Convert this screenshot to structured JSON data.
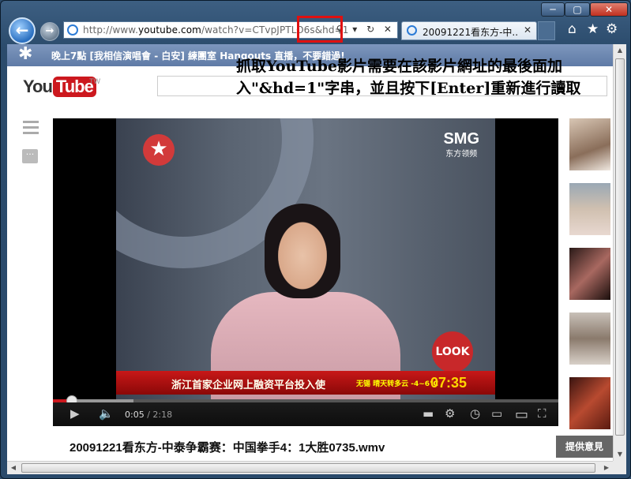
{
  "browser": {
    "url_prefix": "http://www.",
    "url_host": "youtube.com",
    "url_rest": "/watch?v=CTvpJPTLO6s&hd=1",
    "tab_title": "20091221看东方-中...",
    "tab_close": "✕",
    "window": {
      "minimize": "─",
      "maximize": "▢",
      "close": "✕"
    },
    "nav": {
      "back": "←",
      "forward": "→"
    },
    "addr_tools": "⚲ ▾ ↻ ✕",
    "toolbar_icons": {
      "home": "⌂",
      "favorites": "★",
      "settings": "⚙"
    }
  },
  "banner": {
    "icon": "✱",
    "text": "晚上7點 [我相信演唱會 - 白安] 練團室 Hangouts 直播，不要錯過!"
  },
  "logo": {
    "you": "You",
    "tube": "Tube",
    "region": "TW"
  },
  "annotation": "抓取YouTube影片需要在該影片網址的最後面加入\"&hd=1\"字串，並且按下[Enter]重新進行讀取",
  "sidebar": {
    "more": "···"
  },
  "video": {
    "channel_logo": "★",
    "brand": "SMG",
    "brand_sub": "东方领频",
    "look_badge": "LOOK",
    "ticker_main": "浙江首家企业网上融资平台投入使",
    "ticker_weather": "无锡 晴天转多云 -4~6℃",
    "ticker_clock": "07:35"
  },
  "player": {
    "current_time": "0:05",
    "separator": " / ",
    "duration": "2:18",
    "progress_fraction": 0.036,
    "loaded_fraction": 0.16,
    "icons": {
      "play": "▶",
      "volume": "🔈",
      "annotations": "▬",
      "settings": "⚙",
      "watch_later": "◷",
      "small_player": "▭",
      "large_player": "▭",
      "fullscreen": "⛶"
    }
  },
  "video_title": "20091221看东方-中泰争霸赛：中国拳手4：1大胜0735.wmv",
  "feedback_label": "提供意見",
  "scrollbars": {
    "up": "▲",
    "down": "▼",
    "left": "◀",
    "right": "▶"
  },
  "colors": {
    "youtube_red": "#cc181e",
    "highlight_box": "#e01010",
    "banner_blue": "#6b86b0"
  }
}
